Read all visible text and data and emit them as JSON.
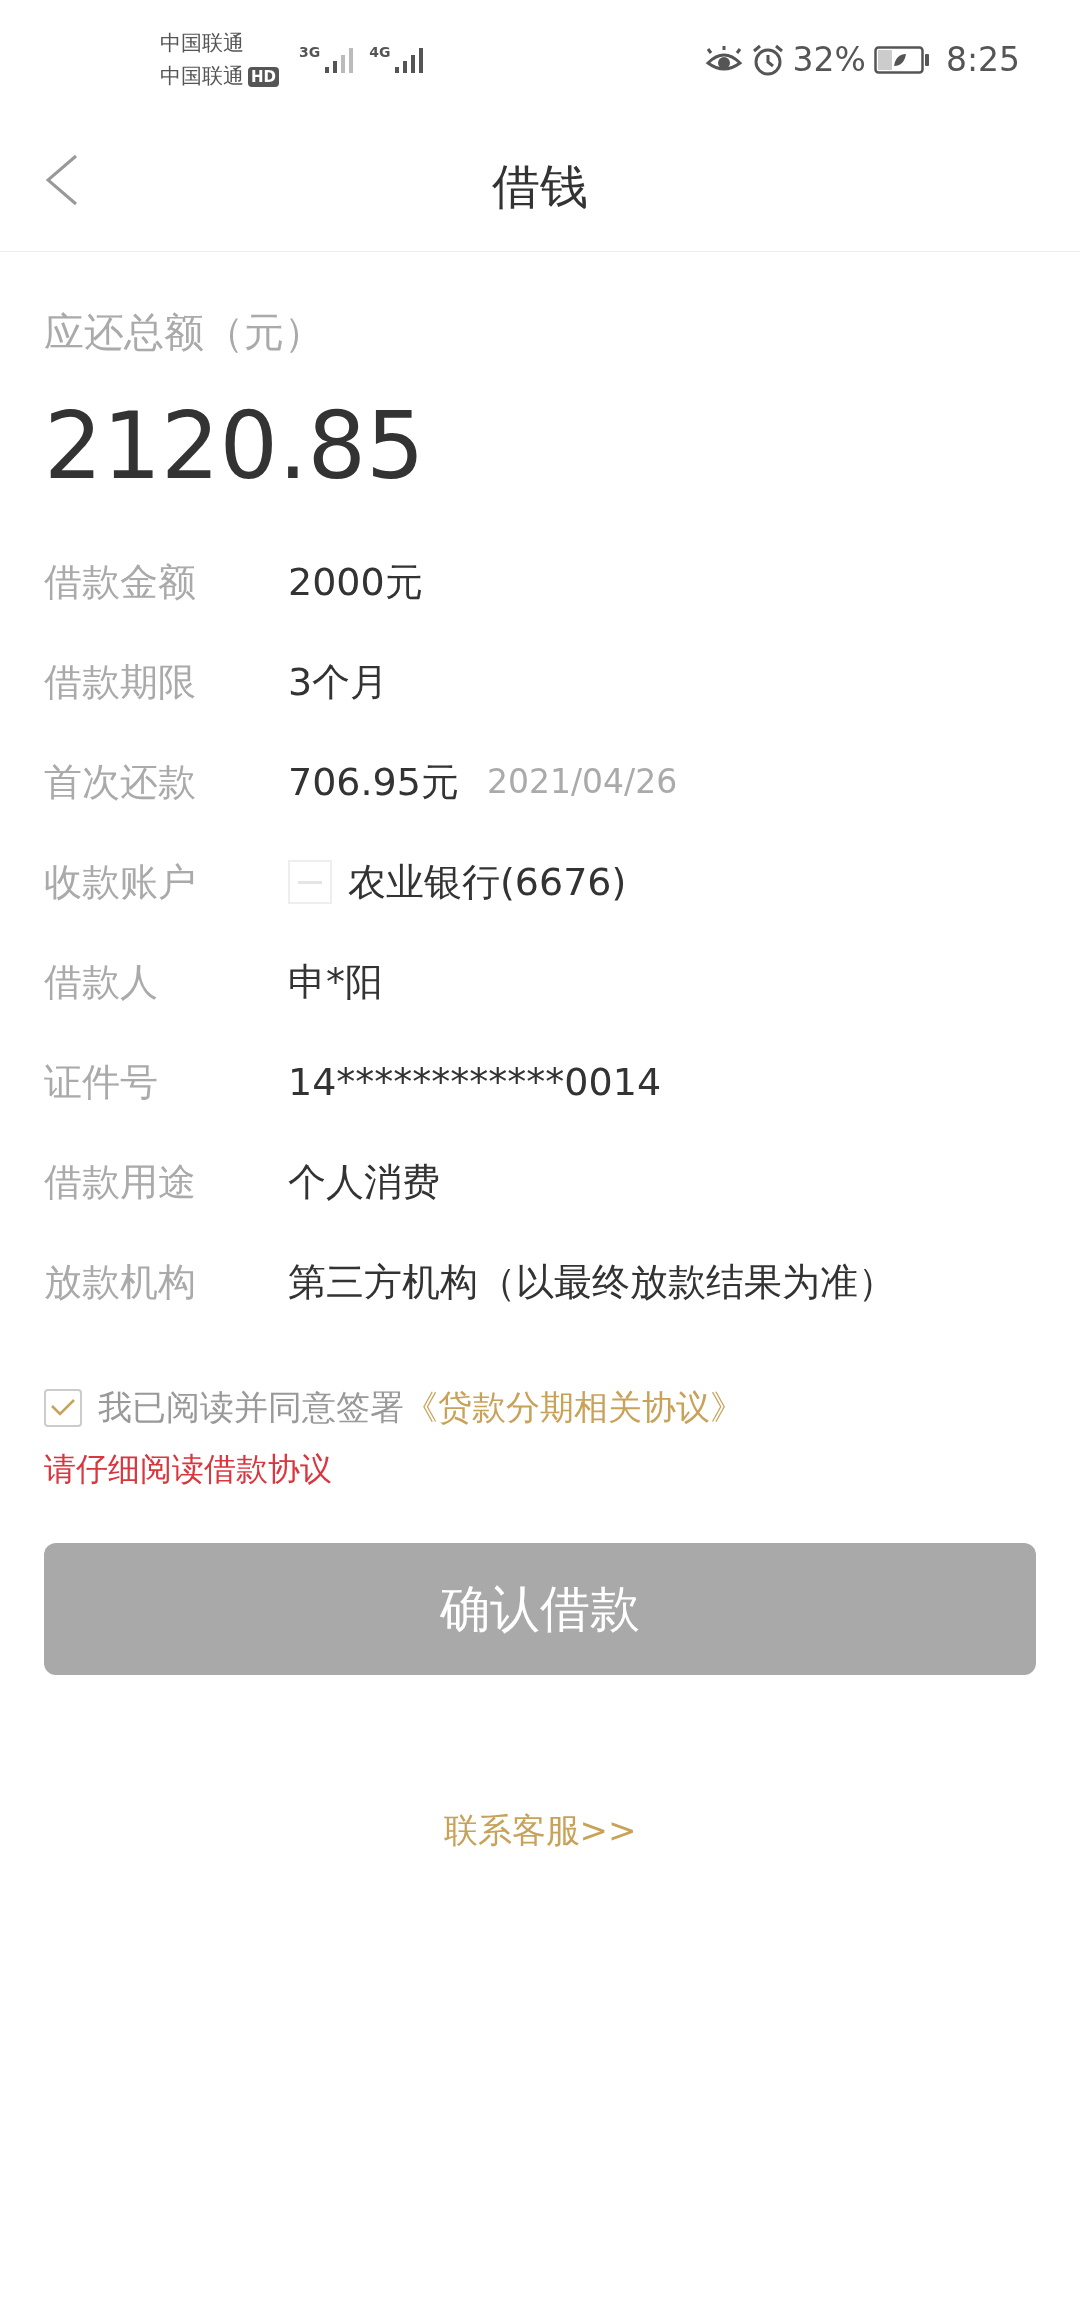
{
  "status_bar": {
    "carriers": [
      {
        "name": "中国联通",
        "hd": false
      },
      {
        "name": "中国联通",
        "hd": true
      }
    ],
    "hd_label": "HD",
    "networks": [
      "3G",
      "4G"
    ],
    "battery": "32%",
    "time": "8:25"
  },
  "header": {
    "title": "借钱"
  },
  "total": {
    "label": "应还总额（元）",
    "amount": "2120.85"
  },
  "rows": [
    {
      "kind": "plain",
      "label": "借款金额",
      "value": "2000元"
    },
    {
      "kind": "plain",
      "label": "借款期限",
      "value": "3个月"
    },
    {
      "kind": "dated",
      "label": "首次还款",
      "value": "706.95元",
      "note": "2021/04/26"
    },
    {
      "kind": "account",
      "label": "收款账户",
      "value": "农业银行(6676)"
    },
    {
      "kind": "plain",
      "label": "借款人",
      "value": "申*阳"
    },
    {
      "kind": "plain",
      "label": "证件号",
      "value": "14************0014"
    },
    {
      "kind": "plain",
      "label": "借款用途",
      "value": "个人消费"
    },
    {
      "kind": "plain",
      "label": "放款机构",
      "value": "第三方机构（以最终放款结果为准）"
    }
  ],
  "agreement": {
    "checked": true,
    "text": "我已阅读并同意签署",
    "link": "《贷款分期相关协议》"
  },
  "warning": "请仔细阅读借款协议",
  "confirm_button": {
    "label": "确认借款",
    "disabled": true
  },
  "contact_link": "联系客服>>"
}
